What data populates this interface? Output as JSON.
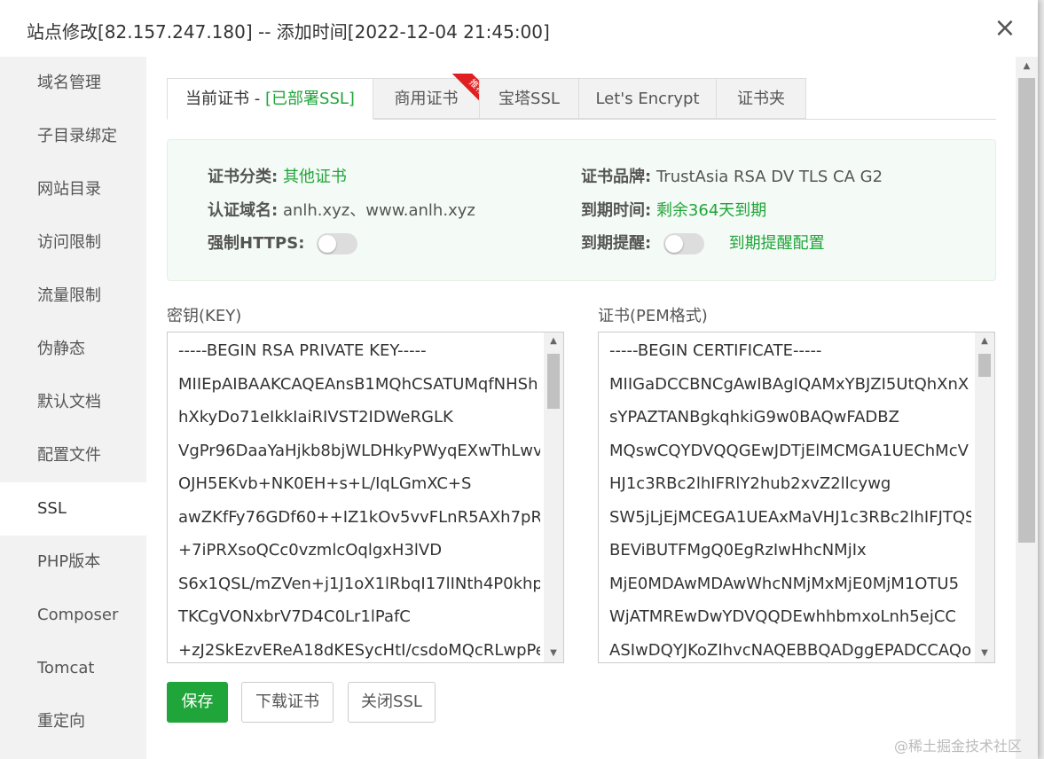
{
  "dialog": {
    "title": "站点修改[82.157.247.180] -- 添加时间[2022-12-04 21:45:00]",
    "close_glyph": "×"
  },
  "sidebar": {
    "items": [
      {
        "label": "域名管理"
      },
      {
        "label": "子目录绑定"
      },
      {
        "label": "网站目录"
      },
      {
        "label": "访问限制"
      },
      {
        "label": "流量限制"
      },
      {
        "label": "伪静态"
      },
      {
        "label": "默认文档"
      },
      {
        "label": "配置文件"
      },
      {
        "label": "SSL",
        "active": true
      },
      {
        "label": "PHP版本"
      },
      {
        "label": "Composer"
      },
      {
        "label": "Tomcat"
      },
      {
        "label": "重定向"
      }
    ]
  },
  "tabs": {
    "current_prefix": "当前证书 - ",
    "current_status": "[已部署SSL]",
    "commercial": "商用证书",
    "commercial_badge": "推荐",
    "baota": "宝塔SSL",
    "letsencrypt": "Let's Encrypt",
    "folder": "证书夹"
  },
  "cert_info": {
    "category_label": "证书分类:",
    "category_value": "其他证书",
    "brand_label": "证书品牌:",
    "brand_value": "TrustAsia RSA DV TLS CA G2",
    "domain_label": "认证域名:",
    "domain_value": "anlh.xyz、www.anlh.xyz",
    "expire_label": "到期时间:",
    "expire_value": "剩余364天到期",
    "https_label": "强制HTTPS:",
    "https_enabled": false,
    "remind_label": "到期提醒:",
    "remind_enabled": false,
    "remind_link": "到期提醒配置"
  },
  "key": {
    "label": "密钥(KEY)",
    "lines": [
      "-----BEGIN RSA PRIVATE KEY-----",
      "MIIEpAIBAAKCAQEAnsB1MQhCSATUMqfNHSh",
      "hXkyDo71eIkkIaiRIVST2IDWeRGLK",
      "VgPr96DaaYaHjkb8bjWLDHkyPWyqEXwThLwv",
      "OJH5EKvb+NK0EH+s+L/IqLGmXC+S",
      "awZKfFy76GDf60++IZ1kOv5vvFLnR5AXh7pRr",
      "+7iPRXsoQCc0vzmlcOqlgxH3lVD",
      "S6x1QSL/mZVen+j1J1oX1lRbqI17lINth4P0khpt",
      "TKCgVONxbrV7D4C0Lr1lPafC",
      "+zJ2SkEzvEReA18dKESycHtI/csdoMQcRLwpPe"
    ]
  },
  "cert": {
    "label": "证书(PEM格式)",
    "lines": [
      "-----BEGIN CERTIFICATE-----",
      "MIIGaDCCBNCgAwIBAgIQAMxYBJZI5UtQhXnX",
      "sYPAZTANBgkqhkiG9w0BAQwFADBZ",
      "MQswCQYDVQQGEwJDTjElMCMGA1UEChMcV",
      "HJ1c3RBc2lhIFRlY2hub2xvZ2llcywg",
      "SW5jLjEjMCEGA1UEAxMaVHJ1c3RBc2lhIFJTQS",
      "BEViBUTFMgQ0EgRzIwHhcNMjIx",
      "MjE0MDAwMDAwWhcNMjMxMjE0MjM1OTU5",
      "WjATMREwDwYDVQQDEwhhbmxoLnh5ejCC",
      "ASIwDQYJKoZIhvcNAQEBBQADggEPADCCAQo"
    ]
  },
  "buttons": {
    "save": "保存",
    "download": "下载证书",
    "close_ssl": "关闭SSL"
  },
  "watermark": "@稀土掘金技术社区",
  "colors": {
    "accent": "#20a53a",
    "badge": "#e02020"
  }
}
